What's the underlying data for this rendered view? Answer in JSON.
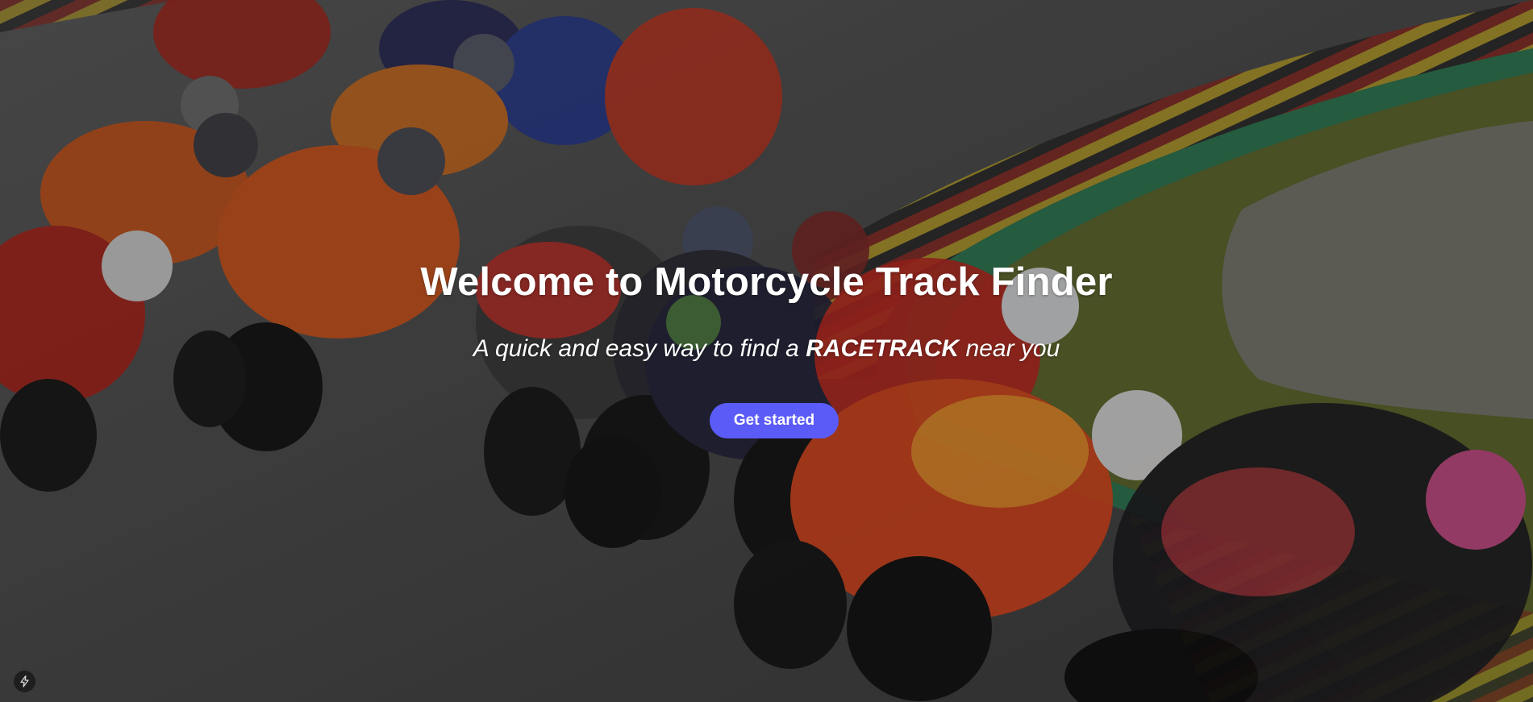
{
  "hero": {
    "title": "Welcome to Motorcycle Track Finder",
    "subtitle_prefix": "A quick and easy way to find a ",
    "subtitle_emphasis": "RACETRACK",
    "subtitle_suffix": " near you",
    "cta_label": "Get started"
  },
  "colors": {
    "accent": "#5b5bf7",
    "text": "#ffffff"
  },
  "icons": {
    "corner_badge": "lightning-icon"
  }
}
